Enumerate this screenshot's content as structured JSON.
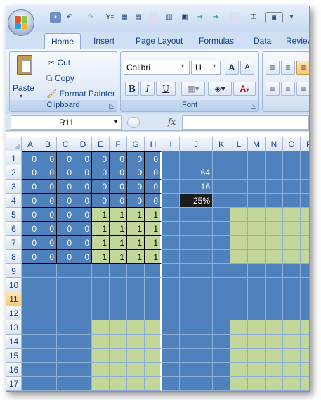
{
  "qat": {
    "icons": [
      "save-icon",
      "undo-icon",
      "redo-icon",
      "grid-icon",
      "chart-icon",
      "camera-icon"
    ]
  },
  "tabs": [
    "Home",
    "Insert",
    "Page Layout",
    "Formulas",
    "Data",
    "Review"
  ],
  "clipboard": {
    "paste": "Paste",
    "cut": "Cut",
    "copy": "Copy",
    "format_painter": "Format Painter",
    "label": "Clipboard"
  },
  "font": {
    "name": "Calibri",
    "size": "11",
    "bold": "B",
    "italic": "I",
    "underline": "U",
    "grow": "A",
    "shrink": "A",
    "color_a": "A",
    "label": "Font"
  },
  "formula_bar": {
    "name_box": "R11",
    "fx": "fx",
    "value": ""
  },
  "columns": [
    "A",
    "B",
    "C",
    "D",
    "E",
    "F",
    "G",
    "H",
    "I",
    "J",
    "K",
    "L",
    "M",
    "N",
    "O",
    "P"
  ],
  "rows": [
    "1",
    "2",
    "3",
    "4",
    "5",
    "6",
    "7",
    "8",
    "9",
    "10",
    "11",
    "12",
    "13",
    "14",
    "15",
    "16",
    "17"
  ],
  "selected_row": "11",
  "values": {
    "r1": [
      "0",
      "0",
      "0",
      "0",
      "0",
      "0",
      "0",
      "0"
    ],
    "r2": [
      "0",
      "0",
      "0",
      "0",
      "0",
      "0",
      "0",
      "0"
    ],
    "r3": [
      "0",
      "0",
      "0",
      "0",
      "0",
      "0",
      "0",
      "0"
    ],
    "r4": [
      "0",
      "0",
      "0",
      "0",
      "0",
      "0",
      "0",
      "0"
    ],
    "r5": [
      "0",
      "0",
      "0",
      "0",
      "1",
      "1",
      "1",
      "1"
    ],
    "r6": [
      "0",
      "0",
      "0",
      "0",
      "1",
      "1",
      "1",
      "1"
    ],
    "r7": [
      "0",
      "0",
      "0",
      "0",
      "1",
      "1",
      "1",
      "1"
    ],
    "r8": [
      "0",
      "0",
      "0",
      "0",
      "1",
      "1",
      "1",
      "1"
    ],
    "j2": "64",
    "j3": "16",
    "j4": "25%"
  },
  "colors": {
    "blue_fill": "#4f81bd",
    "green_fill": "#c4d79b",
    "dark_fill": "#1c1c1c",
    "gridline": "#8eb0d8"
  }
}
